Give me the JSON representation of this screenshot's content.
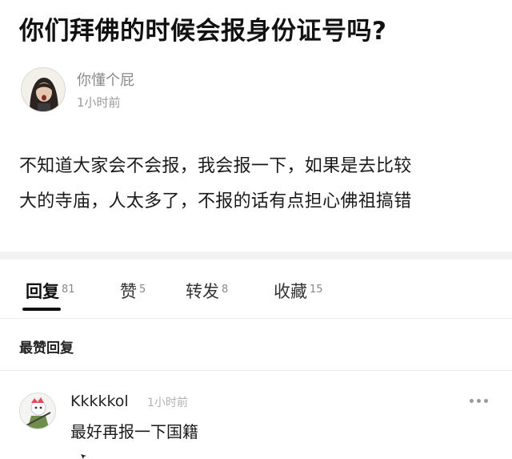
{
  "post": {
    "title": "你们拜佛的时候会报身份证号吗?",
    "author_name": "你懂个屁",
    "post_time": "1小时前",
    "body_lines": [
      "不知道大家会不会报，我会报一下，如果是去比较",
      "大的寺庙，人太多了，不报的话有点担心佛祖搞错"
    ]
  },
  "tabs": [
    {
      "label": "回复",
      "count": "81",
      "active": true
    },
    {
      "label": "赞",
      "count": "5",
      "active": false
    },
    {
      "label": "转发",
      "count": "8",
      "active": false
    },
    {
      "label": "收藏",
      "count": "15",
      "active": false
    }
  ],
  "section": {
    "title": "最赞回复"
  },
  "reply": {
    "author_name": "Kkkkkol",
    "time": "1小时前",
    "text": "最好再报一下国籍",
    "more_icon": "more-dots-icon"
  },
  "colors": {
    "primary_text": "#1a1a1a",
    "secondary_text": "#8a8a8a",
    "divider": "#f2f2f2",
    "tab_underline": "#111111"
  }
}
